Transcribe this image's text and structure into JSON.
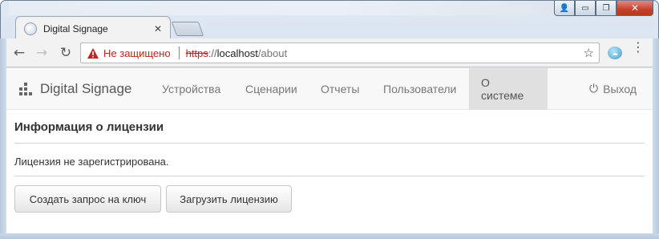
{
  "window": {
    "controls": {
      "user": "👤",
      "minimize": "▭",
      "maximize": "❐",
      "close": "✕"
    }
  },
  "tab": {
    "title": "Digital Signage",
    "close": "✕",
    "favicon": "globe-icon"
  },
  "toolbar": {
    "back": "←",
    "forward": "→",
    "reload": "↻",
    "security_text": "Не защищено",
    "url_scheme": "https",
    "url_sep": "://",
    "url_host": "localhost",
    "url_path": "/about",
    "star": "☆",
    "menu": "⋮"
  },
  "navbar": {
    "brand": "Digital Signage",
    "items": [
      {
        "label": "Устройства"
      },
      {
        "label": "Сценарии"
      },
      {
        "label": "Отчеты"
      },
      {
        "label": "Пользователи"
      },
      {
        "label": "О системе",
        "active": true
      }
    ],
    "logout": "Выход"
  },
  "license": {
    "title": "Информация о лицензии",
    "status": "Лицензия не зарегистрирована.",
    "request_button": "Создать запрос на ключ",
    "upload_button": "Загрузить лицензию"
  },
  "colors": {
    "danger": "#c5221f",
    "navbar_bg": "#f8f8f8",
    "nav_active_bg": "#e0e0e0"
  }
}
